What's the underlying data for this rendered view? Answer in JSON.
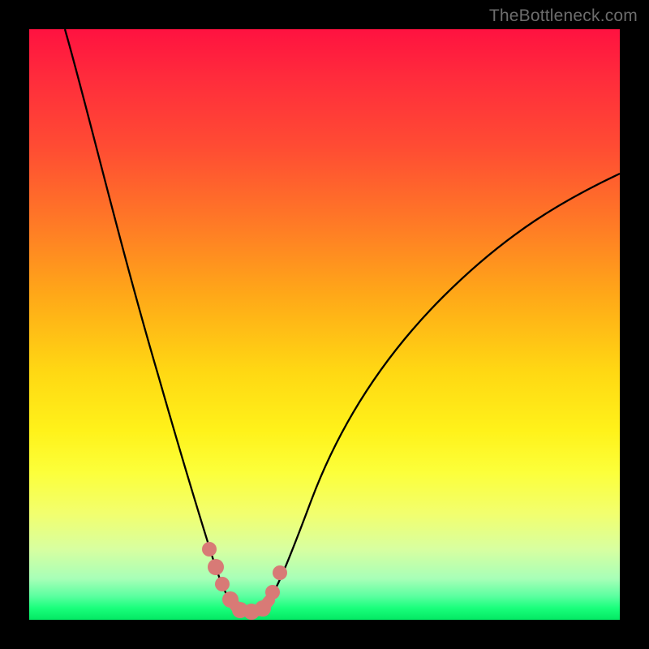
{
  "watermark": "TheBottleneck.com",
  "colors": {
    "marker": "#d87a76",
    "curve": "#000000"
  },
  "chart_data": {
    "type": "line",
    "title": "",
    "xlabel": "",
    "ylabel": "",
    "xlim": [
      0,
      100
    ],
    "ylim": [
      0,
      100
    ],
    "grid": false,
    "series": [
      {
        "name": "left-branch",
        "x": [
          6,
          12,
          18,
          22,
          25,
          27,
          29,
          30.5,
          32,
          33,
          34,
          35
        ],
        "y": [
          100,
          80,
          58,
          44,
          33,
          25,
          17,
          12,
          7.5,
          5,
          3,
          2
        ]
      },
      {
        "name": "right-branch",
        "x": [
          40,
          42,
          45,
          50,
          56,
          64,
          74,
          86,
          100
        ],
        "y": [
          2,
          6,
          12,
          21,
          30,
          40,
          50,
          59,
          67
        ]
      }
    ],
    "markers": {
      "name": "highlight-points",
      "points": [
        {
          "x": 30.5,
          "y": 12
        },
        {
          "x": 31.5,
          "y": 9
        },
        {
          "x": 32.5,
          "y": 6
        },
        {
          "x": 34,
          "y": 2.5
        },
        {
          "x": 36,
          "y": 1.8
        },
        {
          "x": 38,
          "y": 1.8
        },
        {
          "x": 40,
          "y": 2.5
        },
        {
          "x": 41.5,
          "y": 5.5
        },
        {
          "x": 42.5,
          "y": 8.5
        }
      ]
    }
  }
}
